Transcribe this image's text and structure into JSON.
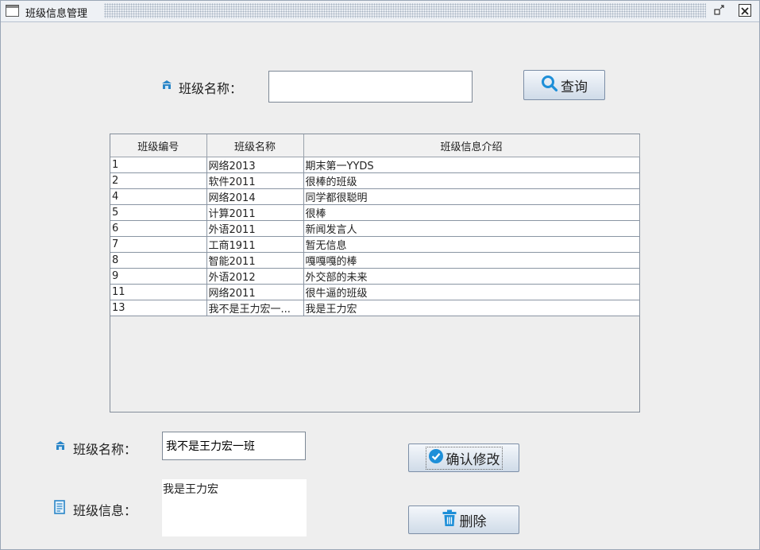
{
  "window": {
    "title": "班级信息管理"
  },
  "search": {
    "label": "班级名称：",
    "value": "",
    "button_label": "查询"
  },
  "table": {
    "columns": [
      "班级编号",
      "班级名称",
      "班级信息介绍"
    ],
    "rows": [
      [
        "1",
        "网络2013",
        "期末第一YYDS"
      ],
      [
        "2",
        "软件2011",
        "很棒的班级"
      ],
      [
        "4",
        "网络2014",
        "同学都很聪明"
      ],
      [
        "5",
        "计算2011",
        "很棒"
      ],
      [
        "6",
        "外语2011",
        "新闻发言人"
      ],
      [
        "7",
        "工商1911",
        "暂无信息"
      ],
      [
        "8",
        "智能2011",
        "嘎嘎嘎的棒"
      ],
      [
        "9",
        "外语2012",
        "外交部的未来"
      ],
      [
        "11",
        "网络2011",
        "很牛逼的班级"
      ],
      [
        "13",
        "我不是王力宏一...",
        "我是王力宏"
      ]
    ]
  },
  "edit": {
    "name_label": "班级名称：",
    "name_value": "我不是王力宏一班",
    "info_label": "班级信息：",
    "info_value": "我是王力宏",
    "confirm_label": "确认修改",
    "delete_label": "删除"
  },
  "colors": {
    "accent": "#1e8fd8",
    "window_border": "#9aa6b6",
    "button_top": "#f4f7fb",
    "button_bottom": "#cfdbe8"
  }
}
